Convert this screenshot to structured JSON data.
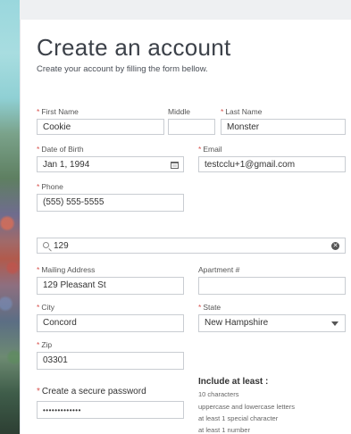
{
  "page": {
    "title": "Create an account",
    "subtitle": "Create your account by filling the form bellow."
  },
  "fields": {
    "first_name": {
      "label": "First Name",
      "value": "Cookie"
    },
    "middle": {
      "label": "Middle",
      "value": ""
    },
    "last_name": {
      "label": "Last Name",
      "value": "Monster"
    },
    "dob": {
      "label": "Date of Birth",
      "value": "Jan 1, 1994"
    },
    "email": {
      "label": "Email",
      "value": "testcclu+1@gmail.com"
    },
    "phone": {
      "label": "Phone",
      "value": "(555) 555-5555"
    },
    "address_search": {
      "value": "129"
    },
    "mailing_address": {
      "label": "Mailing Address",
      "value": "129 Pleasant St"
    },
    "apartment": {
      "label": "Apartment #",
      "value": ""
    },
    "city": {
      "label": "City",
      "value": "Concord"
    },
    "state": {
      "label": "State",
      "value": "New Hampshire"
    },
    "zip": {
      "label": "Zip",
      "value": "03301"
    },
    "password": {
      "label": "Create a secure password",
      "value": "•••••••••••••"
    }
  },
  "requirements": {
    "title": "Include at least :",
    "items": [
      "10 characters",
      "uppercase and lowercase letters",
      "at least 1 special character",
      "at least 1 number"
    ]
  },
  "required_marker": "*",
  "icons": {
    "calendar": "calendar-icon",
    "search": "search-icon",
    "clear": "clear-icon",
    "dropdown": "chevron-down-icon"
  },
  "colors": {
    "required": "#d9534f",
    "border": "#c9cdd2",
    "title": "#3c4149"
  }
}
